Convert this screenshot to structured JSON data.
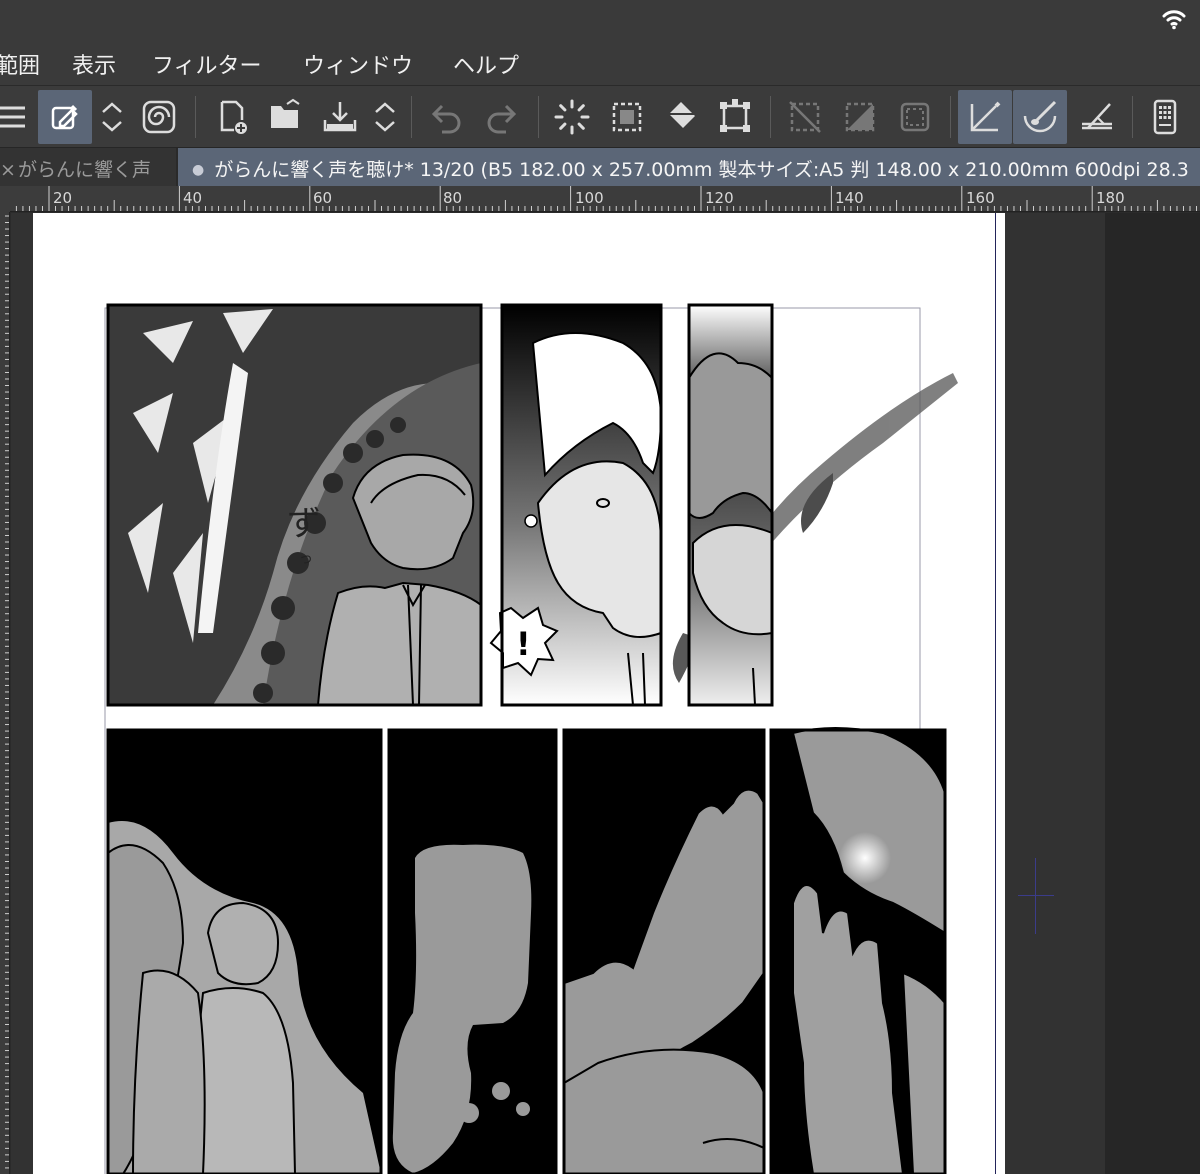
{
  "menu": [
    "範囲",
    "表示",
    "フィルター",
    "ウィンドウ",
    "ヘルプ"
  ],
  "toolbar_icons": [
    "menu-icon",
    "eyedropper-icon",
    "updown-icon",
    "spiral-icon",
    "new-page-icon",
    "open-folder-icon",
    "save-icon",
    "updown-icon",
    "undo-icon",
    "redo-icon",
    "selection-spinner-icon",
    "select-rect-icon",
    "fill-bucket-icon",
    "transform-icon",
    "select-clear-icon",
    "select-invert-icon",
    "select-border-icon",
    "ruler-snap-icon",
    "brush-snap-icon",
    "perspective-snap-icon",
    "tablet-icon"
  ],
  "tabs": {
    "inactive_close": "×",
    "inactive_label": "がらんに響く声",
    "active_dot": "●",
    "active_label": "がらんに響く声を聴け* 13/20 (B5 182.00 x 257.00mm 製本サイズ:A5 判 148.00 x 210.00mm 600dpi 28.3"
  },
  "ruler_labels": [
    "20",
    "40",
    "60",
    "80",
    "100",
    "120",
    "140",
    "160",
    "180"
  ],
  "sfx": {
    "zu": "ず",
    "small": "っ",
    "exclaim": "!"
  }
}
